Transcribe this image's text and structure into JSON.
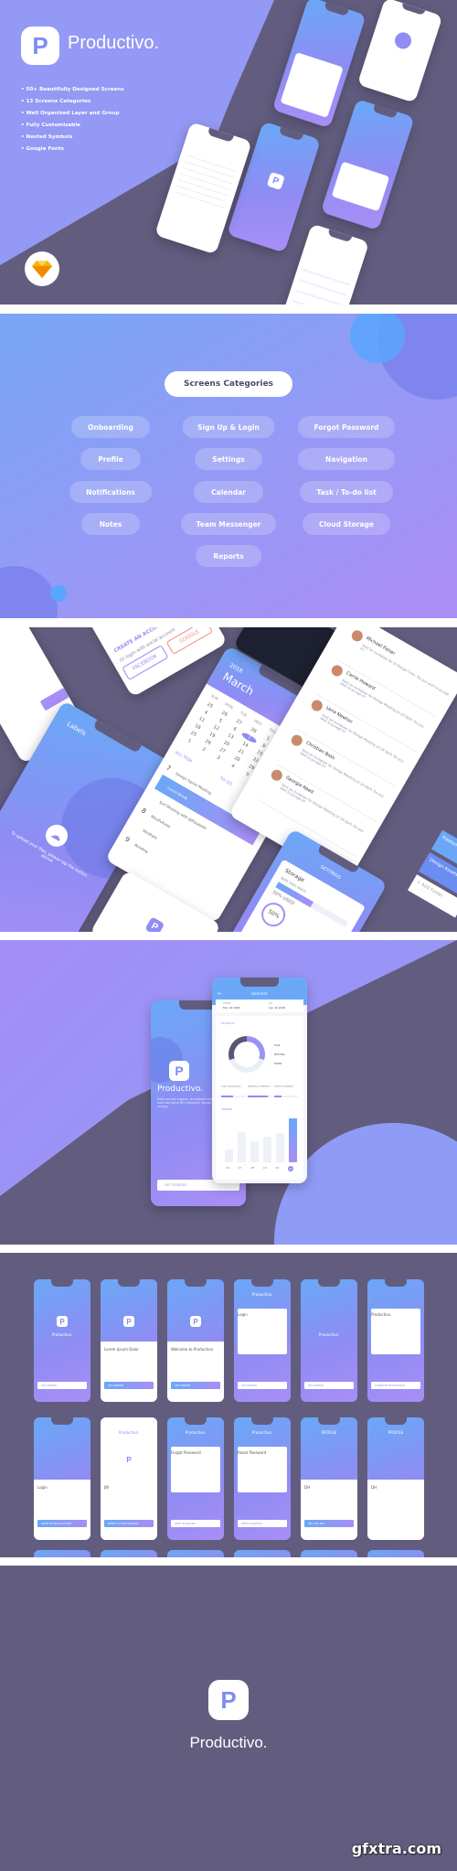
{
  "brand": {
    "name": "Productivo.",
    "logo_letter": "P"
  },
  "hero": {
    "features": [
      "• 50+ Beautifully Designed Screens",
      "• 13 Screens Categories",
      "• Well Organized Layer and Group",
      "• Fully Customizable",
      "• Nested Symbols",
      "• Google Fonts"
    ],
    "sketch_icon": "sketch-diamond-icon"
  },
  "categories": {
    "title": "Screens Categories",
    "items": [
      "Onboarding",
      "Sign Up & Login",
      "Forgot Password",
      "Profile",
      "Settings",
      "Navigation",
      "Notifications",
      "Calendar",
      "Task / To-do list",
      "Notes",
      "Team Messenger",
      "Cloud Storage",
      "Reports"
    ]
  },
  "showcase": {
    "labels": {
      "title": "Labels",
      "upload_text": "To upload your files, please tap the button above"
    },
    "social": {
      "create": "CREATE AN ACCOUNT",
      "or": "Or login with social account",
      "facebook": "FACEBOOK",
      "google": "GOOGLE"
    },
    "calendar": {
      "year": "2018",
      "month": "March",
      "weekdays": [
        "SUN",
        "MON",
        "TUE",
        "WED",
        "THU",
        "FRI",
        "SAT"
      ],
      "days": [
        "25",
        "26",
        "27",
        "28",
        "1",
        "2",
        "3",
        "4",
        "5",
        "6",
        "7",
        "8",
        "9",
        "10",
        "11",
        "12",
        "13",
        "14",
        "15",
        "16",
        "17",
        "18",
        "19",
        "20",
        "21",
        "22",
        "23",
        "24",
        "25",
        "26",
        "27",
        "28",
        "29",
        "30",
        "31",
        "1",
        "2",
        "3",
        "4",
        "5",
        "6",
        "7"
      ],
      "selected": "7",
      "tabs": [
        "ALL TASK",
        "TO-DO",
        "EVENTS"
      ],
      "tasks": [
        {
          "day": "7",
          "name": "Design Sprint Meeting"
        },
        {
          "day": "",
          "name": "Lunch Break"
        },
        {
          "day": "",
          "name": "Sort Meeting with @Elizabeth"
        },
        {
          "day": "8",
          "name": "Mindfulness"
        },
        {
          "day": "",
          "name": "Meditate"
        },
        {
          "day": "9",
          "name": "Reading"
        }
      ]
    },
    "notifications": [
      {
        "name": "Michael Fisher",
        "text": "Sent an invitation for UI Design Critic. Do you wish to accept it?"
      },
      {
        "name": "Carrie Howard",
        "text": "Sent an invitation for Design Meeting on 24 April. Do you wish to accept it?"
      },
      {
        "name": "Lena Newton",
        "text": "Sent an invitation for Design Meeting on 24 April. Do you wish to accept it?"
      },
      {
        "name": "Christian Bass",
        "text": "Sent an invitation for Design Meeting on 24 April. Do you wish to accept it?"
      },
      {
        "name": "Georgia Reed",
        "text": "Sent an invitation for Design Meeting on 24 April. Do you wish to accept it?"
      }
    ],
    "notif_days": [
      "6",
      "5"
    ],
    "settings": {
      "title": "SETTINGS",
      "storage": "Storage",
      "base": "BASE FREE SPACE",
      "used": "50% USED",
      "percent": "50%"
    },
    "folders": [
      "Freelance",
      "Design Assets",
      "+ Add Folder"
    ]
  },
  "reports": {
    "title": "REPORTS",
    "from_label": "FROM",
    "from": "Feb. 24 2018",
    "to_label": "TO",
    "to": "Apr. 10 2018",
    "statistic": "STATISTIC",
    "legend": [
      "TASK",
      "MEETING",
      "EVENT"
    ],
    "stats": [
      {
        "label": "TASK COMPLETED",
        "fill": 0.5
      },
      {
        "label": "MEETING ATTENDED",
        "fill": 0.85
      },
      {
        "label": "EVENT ATTENDED",
        "fill": 0.3
      }
    ],
    "trends": "TRENDS",
    "days": [
      "16",
      "17",
      "18",
      "19",
      "20",
      "21"
    ],
    "trend_values": [
      0.3,
      0.68,
      0.47,
      0.59,
      0.67,
      1.0
    ],
    "selected_day": "21",
    "donut": [
      {
        "name": "TASK",
        "share": 0.3,
        "color": "#9a93f5"
      },
      {
        "name": "MEETING",
        "share": 0.4,
        "color": "#e9eef7"
      },
      {
        "name": "EVENT",
        "share": 0.3,
        "color": "#5a5678"
      }
    ],
    "splash_text": "Retro occupy organic, stumptown shabby chic pour-over roof party DIY normcore. Actually artisan organic occupy.",
    "get_started": "GET STARTED"
  },
  "grid": {
    "screens": [
      {
        "title": "Productivo.",
        "logo": true,
        "button": "GET STARTED",
        "style": "grad"
      },
      {
        "title": "Lorem Ipsum Dolor",
        "logo": true,
        "button": "GET STARTED",
        "style": "half"
      },
      {
        "title": "Welcome to Productivo",
        "logo": true,
        "button": "GET STARTED",
        "style": "half"
      },
      {
        "title": "Login",
        "logo": false,
        "button": "GET STARTED",
        "style": "card",
        "header": "Productivo."
      },
      {
        "title": "Productivo.",
        "logo": false,
        "button": "GET STARTED",
        "style": "grad"
      },
      {
        "title": "Productivo.",
        "logo": false,
        "button": "COMPLETE REGISTRATION",
        "style": "card"
      },
      {
        "title": "Login",
        "logo": false,
        "button": "LOGIN TO YOUR ACCOUNT",
        "style": "half"
      },
      {
        "title": "JW",
        "logo": true,
        "button": "ENTER TO YOUR ACCOUNT",
        "style": "white",
        "header": "Productivo."
      },
      {
        "title": "Forgot Password",
        "logo": false,
        "button": "RESET PASSWORD",
        "style": "card",
        "header": "Productivo."
      },
      {
        "title": "Reset Password",
        "logo": false,
        "button": "RESET PASSWORD",
        "style": "card",
        "header": "Productivo."
      },
      {
        "title": "DH",
        "logo": false,
        "button": "50%  75%  25%",
        "style": "half",
        "header": "PROFILE"
      },
      {
        "title": "DH",
        "logo": false,
        "button": "",
        "style": "half",
        "header": "PROFILE"
      }
    ]
  },
  "watermark": "gfxtra.com",
  "colors": {
    "accent": "#8f8cf3",
    "dark": "#625d7f",
    "blue": "#6aa8f7",
    "purple": "#a88ef6"
  }
}
